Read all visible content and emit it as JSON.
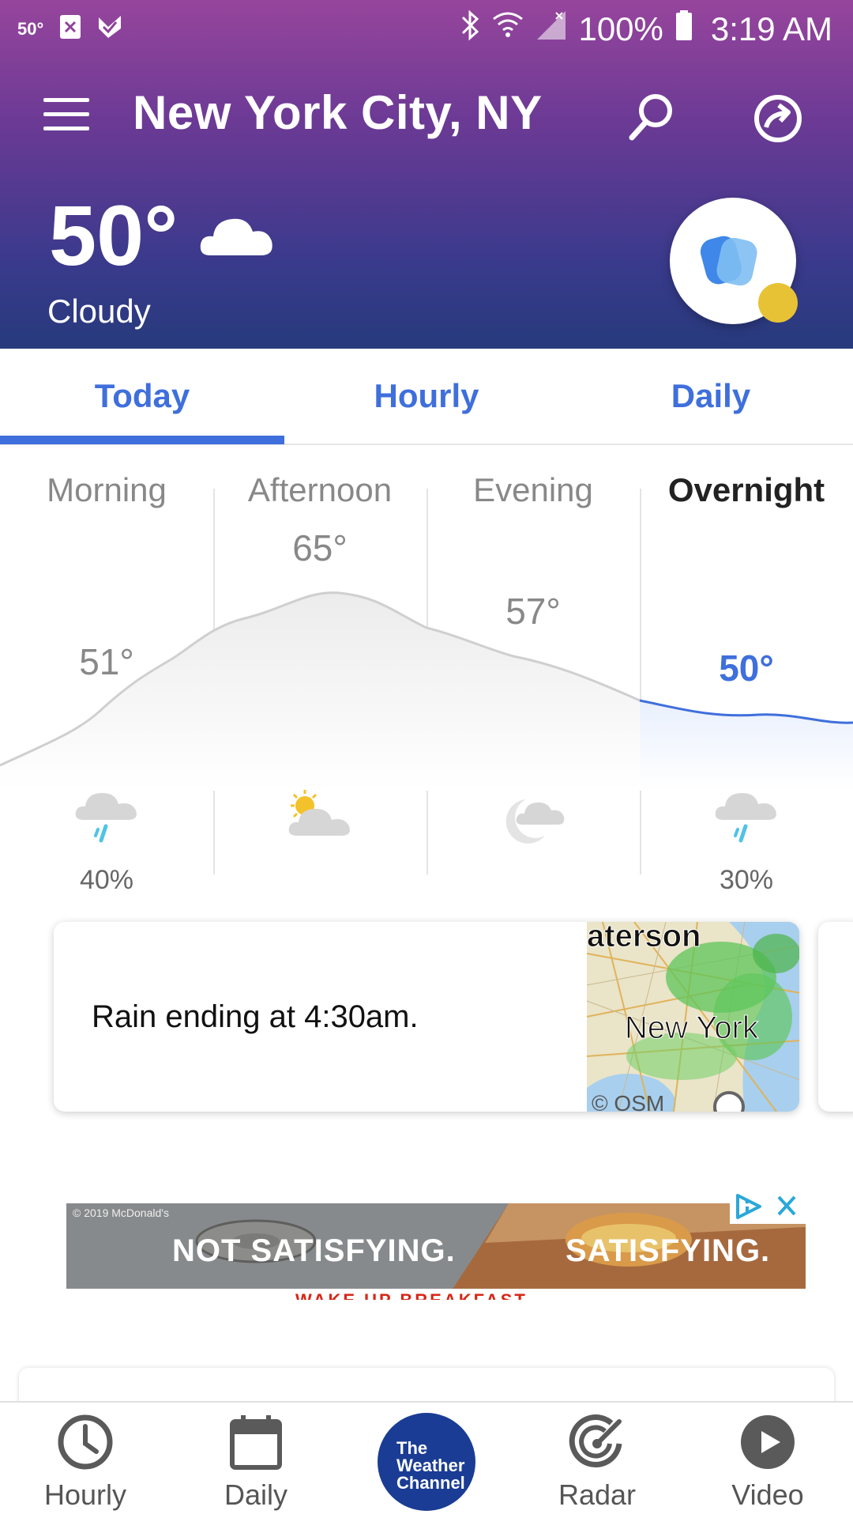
{
  "status_bar": {
    "temp": "50°",
    "battery": "100%",
    "time": "3:19 AM"
  },
  "header": {
    "city": "New York City, NY",
    "current_temp": "50°",
    "condition": "Cloudy"
  },
  "tabs": [
    {
      "label": "Today",
      "active": true
    },
    {
      "label": "Hourly",
      "active": false
    },
    {
      "label": "Daily",
      "active": false
    }
  ],
  "dayparts": [
    {
      "label": "Morning",
      "temp": "51°",
      "icon": "rain-cloud-icon",
      "precip": "40%"
    },
    {
      "label": "Afternoon",
      "temp": "65°",
      "icon": "partly-sunny-icon",
      "precip": ""
    },
    {
      "label": "Evening",
      "temp": "57°",
      "icon": "partly-cloudy-night-icon",
      "precip": ""
    },
    {
      "label": "Overnight",
      "temp": "50°",
      "icon": "rain-cloud-icon",
      "precip": "30%"
    }
  ],
  "rain_card": {
    "message": "Rain ending at 4:30am.",
    "map_labels": {
      "top": "aterson",
      "city": "New York",
      "credit": "© OSM"
    }
  },
  "ad": {
    "brand_note": "© 2019 McDonald's",
    "left_text": "NOT SATISFYING.",
    "right_text": "SATISFYING.",
    "bottom_text": "WAKE UP BREAKFAST"
  },
  "bottom_nav": [
    {
      "label": "Hourly",
      "icon": "clock-icon"
    },
    {
      "label": "Daily",
      "icon": "calendar-icon"
    },
    {
      "label": "",
      "icon": "the-weather-channel-logo"
    },
    {
      "label": "Radar",
      "icon": "radar-icon"
    },
    {
      "label": "Video",
      "icon": "play-icon"
    }
  ],
  "logo_text": [
    "The",
    "Weather",
    "Channel"
  ],
  "colors": {
    "accent": "#3f6fdc",
    "header_top": "#97459c",
    "header_bottom": "#273a7c",
    "logo": "#1a3c94",
    "assistant_dot": "#e7c234"
  }
}
